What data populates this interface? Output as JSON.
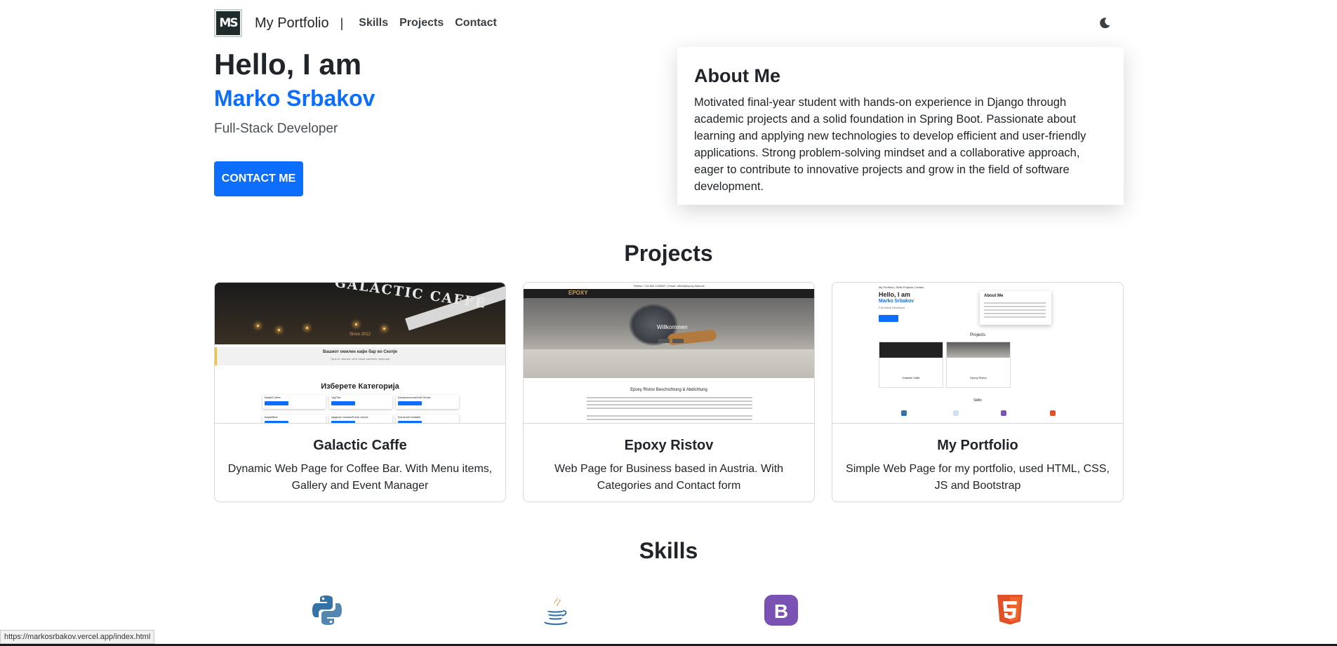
{
  "navbar": {
    "logo_text": "MS",
    "brand": "My Portfolio",
    "separator": "|",
    "links": [
      "Skills",
      "Projects",
      "Contact"
    ],
    "theme_icon": "moon-icon"
  },
  "hero": {
    "greeting": "Hello, I am",
    "name": "Marko Srbakov",
    "role": "Full-Stack Developer",
    "contact_button": "CONTACT ME"
  },
  "about": {
    "title": "About Me",
    "text": "Motivated final-year student with hands-on experience in Django through academic projects and a solid foundation in Spring Boot. Passionate about learning and applying new technologies to develop efficient and user-friendly applications. Strong problem-solving mindset and a collaborative approach, eager to contribute to innovative projects and grow in the field of software development."
  },
  "projects": {
    "title": "Projects",
    "items": [
      {
        "title": "Galactic Caffe",
        "description": "Dynamic Web Page for Coffee Bar. With Menu items, Gallery and Event Manager",
        "thumb": {
          "sign": "GALACTIC CAFFE",
          "since": "Since 2012",
          "banner_title": "Вашиот омилен кафе бар во Скопје",
          "banner_sub": "Тука се наоѓаат сите наши омилени пијалоци",
          "category_heading": "Изберете Категорија",
          "boxes": [
            "Кафе/Coffee",
            "Чај/Tea",
            "Безалкохолни/Soft Drinks",
            "Бира/Beer",
            "Цедени Сокови/Fresh Juices",
            "Коктели/Cocktails"
          ]
        }
      },
      {
        "title": "Epoxy Ristov",
        "description": "Web Page for Business based in Austria. With Categories and Contact form",
        "thumb": {
          "topbar": "Telefon: +43 660 1234567 | Email: office@epoxy-ristov.at",
          "logo": "EPOXY",
          "welcome": "Willkommen",
          "heading": "Epoxy Ristov Beschichtung & Abdichtung"
        }
      },
      {
        "title": "My Portfolio",
        "description": "Simple Web Page for my portfolio, used HTML, CSS, JS and Bootstrap",
        "thumb": {
          "nav": "My Portfolio  |  Skills  Projects  Contact",
          "hello": "Hello, I am",
          "name": "Marko Srbakov",
          "role": "Full-Stack Developer",
          "about": "About Me",
          "projects": "Projects",
          "card1": "Galactic Caffe",
          "card2": "Epoxy Ristov",
          "skills": "Skills"
        }
      }
    ]
  },
  "skills": {
    "title": "Skills",
    "icons": [
      "python-icon",
      "java-icon",
      "bootstrap-icon",
      "html5-icon"
    ]
  },
  "status_bar": {
    "url": "https://markosrbakov.vercel.app/index.html"
  },
  "colors": {
    "accent": "#0d6efd",
    "text": "#212529",
    "bootstrap": "#7952b3",
    "html5": "#e34f26",
    "python_blue": "#3572a5",
    "python_yellow": "#ffd43b",
    "java_blue": "#2f6fa7",
    "java_red": "#e76f00"
  }
}
